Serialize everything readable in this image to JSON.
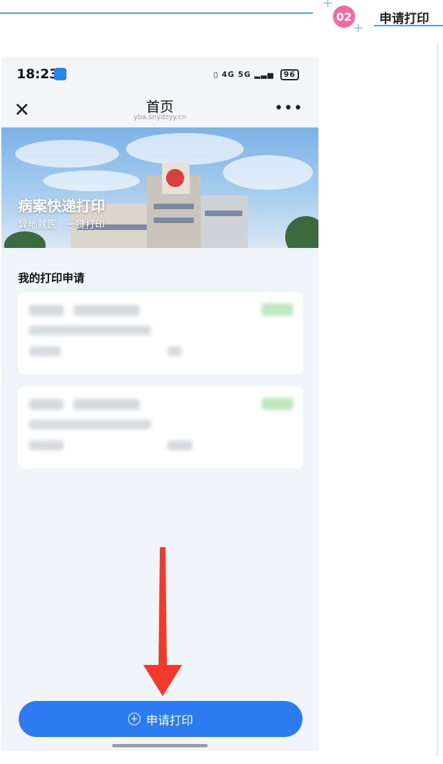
{
  "article_header": {
    "step_number": "02",
    "step_title": "申请打印"
  },
  "status_bar": {
    "time": "18:23",
    "battery": "96",
    "network": "4G 5G"
  },
  "nav": {
    "title": "首页",
    "url": "yba.snydzyy.cn"
  },
  "banner": {
    "title": "病案快递打印",
    "subtitle": "异地就医 · 一键打印"
  },
  "section": {
    "title": "我的打印申请"
  },
  "apply_button": {
    "label": "申请打印",
    "color": "#2c7bf0"
  },
  "colors": {
    "accent_blue": "#4aa3e8",
    "badge_pink": "#f16aa0",
    "arrow_red": "#f03b2c"
  }
}
